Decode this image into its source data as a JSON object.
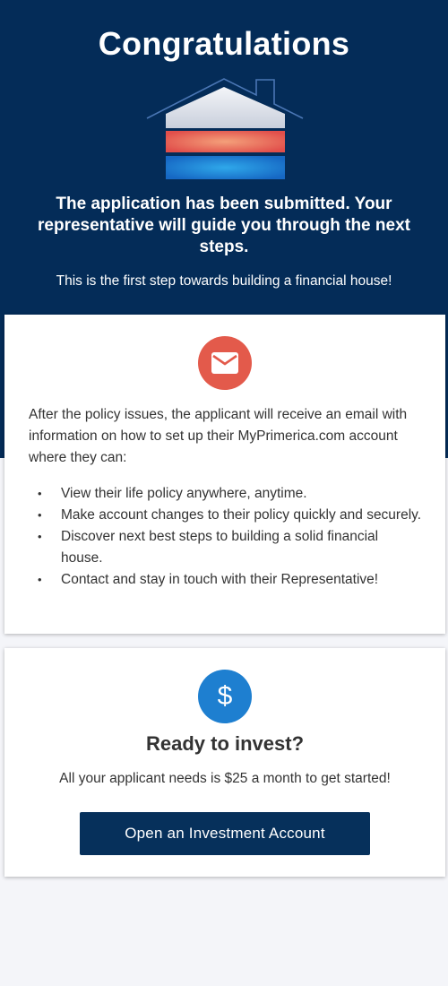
{
  "header": {
    "title": "Congratulations",
    "message": "The application has been submitted. Your representative will guide you through the next steps.",
    "subtitle": "This is the first step towards building a financial house!"
  },
  "icons": {
    "house": "house-icon",
    "mail": "mail-icon",
    "dollar": "dollar-icon"
  },
  "email_card": {
    "intro": "After the policy issues, the applicant will receive an email with information on how to set up their MyPrimerica.com account where they can:",
    "bullets": [
      "View their life policy anywhere, anytime.",
      "Make account changes to their policy quickly and securely.",
      "Discover next best steps to building a solid financial house.",
      "Contact and stay in touch with their Representative!"
    ]
  },
  "invest_card": {
    "dollar_symbol": "$",
    "heading": "Ready to invest?",
    "text": "All your applicant needs is $25 a month to get started!",
    "button_label": "Open an Investment Account"
  },
  "colors": {
    "header_bg": "#042c58",
    "page_bg": "#f4f5f9",
    "mail_circle": "#e35a4b",
    "dollar_circle": "#1e7fd0",
    "button_bg": "#06305b"
  }
}
